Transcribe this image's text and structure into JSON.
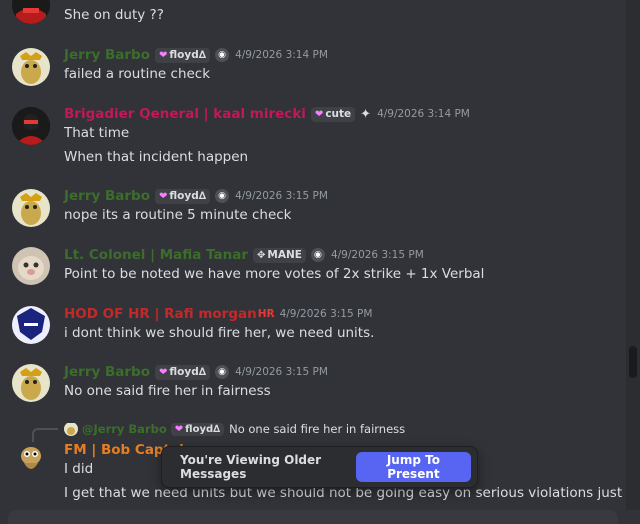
{
  "messages": [
    {
      "id": "m0",
      "lines": [
        "She on duty ??"
      ]
    },
    {
      "id": "m1",
      "username": "Jerry Barbo",
      "tag": "floyd∆",
      "timestamp": "4/9/2026 3:14 PM",
      "lines": [
        "failed a routine check"
      ]
    },
    {
      "id": "m2",
      "username": "Brigadier Qeneral | kaal mirecki",
      "tag": "cute",
      "timestamp": "4/9/2026 3:14 PM",
      "lines": [
        "That time",
        "When that incident happen"
      ]
    },
    {
      "id": "m3",
      "username": "Jerry Barbo",
      "tag": "floyd∆",
      "timestamp": "4/9/2026 3:15 PM",
      "lines": [
        "nope its a routine 5 minute check"
      ]
    },
    {
      "id": "m4",
      "username": "Lt. Colonel | Mafia Tanar",
      "tag": "MANE",
      "timestamp": "4/9/2026 3:15 PM",
      "lines": [
        "Point to be noted  we have more votes of 2x strike + 1x Verbal"
      ]
    },
    {
      "id": "m5",
      "username": "HOD OF HR | Rafi morgan",
      "suffix": "HR",
      "timestamp": "4/9/2026 3:15 PM",
      "lines": [
        "i dont think we should fire her, we need units."
      ]
    },
    {
      "id": "m6",
      "username": "Jerry Barbo",
      "tag": "floyd∆",
      "timestamp": "4/9/2026 3:15 PM",
      "lines": [
        "No one said fire her in fairness"
      ]
    },
    {
      "id": "m7",
      "username": "FM | Bob Captain",
      "reply": {
        "username": "@Jerry Barbo",
        "tag": "floyd∆",
        "text": "No one said fire her in fairness"
      },
      "lines": [
        "I did",
        "I get that we need units but we should not be going easy on serious violations just"
      ]
    }
  ],
  "banner": {
    "text": "You're Viewing Older Messages",
    "button": "Jump To Present"
  },
  "colors": {
    "background": "#313338",
    "accent": "#5865f2",
    "jerry": "#3b6e2a",
    "brigadier": "#c2185b",
    "hod": "#c62828",
    "fm": "#e67e22"
  },
  "icons": {
    "heart": "heart-icon",
    "diamond": "diamond-move-icon",
    "sparkle": "sparkle-icon",
    "badge": "role-badge-icon"
  }
}
